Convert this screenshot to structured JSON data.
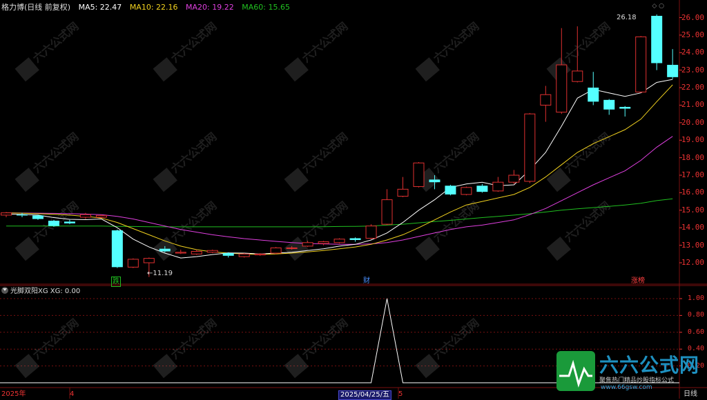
{
  "stock": {
    "name": "格力博(日线 前复权)"
  },
  "ma_labels": [
    {
      "text": "MA5: 22.47",
      "color": "#ffffff"
    },
    {
      "text": "MA10: 22.16",
      "color": "#f2d21f"
    },
    {
      "text": "MA20: 19.22",
      "color": "#e040e0"
    },
    {
      "text": "MA60: 15.65",
      "color": "#20c020"
    }
  ],
  "indicator": {
    "label": "光脚双阳XG  XG: 0.00"
  },
  "price_axis": [
    "26.00",
    "25.00",
    "24.00",
    "23.00",
    "22.00",
    "21.00",
    "20.00",
    "19.00",
    "18.00",
    "17.00",
    "16.00",
    "15.00",
    "14.00",
    "13.00",
    "12.00"
  ],
  "indicator_axis": [
    "1.00",
    "0.80",
    "0.60",
    "0.40",
    "0.20"
  ],
  "annotations": {
    "high": "26.18",
    "low": "11.19"
  },
  "event_markers": [
    {
      "text": "跌",
      "color": "#20c020"
    },
    {
      "text": "财",
      "color": "#4a90ff"
    },
    {
      "text": "涨榜",
      "color": "#ff4040"
    }
  ],
  "x_labels": {
    "year": "2025年",
    "m4": "4",
    "date": "2025/04/25/五",
    "m5": "5",
    "period": "日线"
  },
  "watermark": {
    "title": "六六公式网",
    "subtitle": "聚焦热门精品炒股指标公式",
    "url": "www.66gsw.com"
  },
  "colors": {
    "up": "#e03030",
    "down": "#54ffff",
    "ma5": "#ffffff",
    "ma10": "#f2d21f",
    "ma20": "#e040e0",
    "ma60": "#20c020",
    "grid": "#7a1010"
  },
  "chart_data": {
    "type": "candlestick",
    "ylim": [
      11.0,
      26.6
    ],
    "candles": [
      {
        "o": 14.72,
        "c": 14.85,
        "h": 14.9,
        "l": 14.6
      },
      {
        "o": 14.75,
        "c": 14.7,
        "h": 14.85,
        "l": 14.6
      },
      {
        "o": 14.7,
        "c": 14.5,
        "h": 14.75,
        "l": 14.45
      },
      {
        "o": 14.4,
        "c": 14.1,
        "h": 14.45,
        "l": 14.05
      },
      {
        "o": 14.35,
        "c": 14.25,
        "h": 14.45,
        "l": 14.2
      },
      {
        "o": 14.6,
        "c": 14.75,
        "h": 14.85,
        "l": 14.5
      },
      {
        "o": 14.6,
        "c": 14.7,
        "h": 14.75,
        "l": 14.55
      },
      {
        "o": 13.85,
        "c": 11.75,
        "h": 13.9,
        "l": 11.7
      },
      {
        "o": 11.75,
        "c": 12.2,
        "h": 12.25,
        "l": 11.7
      },
      {
        "o": 12.0,
        "c": 12.25,
        "h": 12.3,
        "l": 11.19
      },
      {
        "o": 12.8,
        "c": 12.65,
        "h": 12.95,
        "l": 12.6
      },
      {
        "o": 12.55,
        "c": 12.6,
        "h": 12.75,
        "l": 12.5
      },
      {
        "o": 12.5,
        "c": 12.65,
        "h": 12.75,
        "l": 12.45
      },
      {
        "o": 12.6,
        "c": 12.7,
        "h": 12.75,
        "l": 12.55
      },
      {
        "o": 12.55,
        "c": 12.4,
        "h": 12.6,
        "l": 12.3
      },
      {
        "o": 12.35,
        "c": 12.5,
        "h": 12.55,
        "l": 12.3
      },
      {
        "o": 12.45,
        "c": 12.5,
        "h": 12.55,
        "l": 12.4
      },
      {
        "o": 12.55,
        "c": 12.85,
        "h": 12.9,
        "l": 12.5
      },
      {
        "o": 12.85,
        "c": 12.85,
        "h": 12.95,
        "l": 12.75
      },
      {
        "o": 12.95,
        "c": 13.15,
        "h": 13.25,
        "l": 12.9
      },
      {
        "o": 13.1,
        "c": 13.2,
        "h": 13.25,
        "l": 13.0
      },
      {
        "o": 13.15,
        "c": 13.35,
        "h": 13.4,
        "l": 13.1
      },
      {
        "o": 13.4,
        "c": 13.3,
        "h": 13.45,
        "l": 13.2
      },
      {
        "o": 13.4,
        "c": 14.1,
        "h": 14.2,
        "l": 13.35
      },
      {
        "o": 14.2,
        "c": 15.6,
        "h": 16.2,
        "l": 14.15
      },
      {
        "o": 15.8,
        "c": 16.2,
        "h": 16.9,
        "l": 15.75
      },
      {
        "o": 16.35,
        "c": 17.7,
        "h": 17.75,
        "l": 16.3
      },
      {
        "o": 16.75,
        "c": 16.6,
        "h": 17.0,
        "l": 16.2
      },
      {
        "o": 16.4,
        "c": 15.9,
        "h": 16.45,
        "l": 15.85
      },
      {
        "o": 15.9,
        "c": 16.3,
        "h": 16.35,
        "l": 15.85
      },
      {
        "o": 16.4,
        "c": 16.05,
        "h": 16.5,
        "l": 16.0
      },
      {
        "o": 16.1,
        "c": 16.6,
        "h": 16.9,
        "l": 16.05
      },
      {
        "o": 16.6,
        "c": 17.0,
        "h": 17.3,
        "l": 16.5
      },
      {
        "o": 16.65,
        "c": 20.5,
        "h": 20.55,
        "l": 16.55
      },
      {
        "o": 21.0,
        "c": 21.6,
        "h": 22.1,
        "l": 20.05
      },
      {
        "o": 20.6,
        "c": 23.3,
        "h": 25.4,
        "l": 20.5
      },
      {
        "o": 22.35,
        "c": 22.95,
        "h": 25.5,
        "l": 22.3
      },
      {
        "o": 22.0,
        "c": 21.2,
        "h": 22.9,
        "l": 21.0
      },
      {
        "o": 21.3,
        "c": 20.75,
        "h": 21.35,
        "l": 20.45
      },
      {
        "o": 20.9,
        "c": 20.8,
        "h": 20.95,
        "l": 20.35
      },
      {
        "o": 21.75,
        "c": 24.9,
        "h": 24.95,
        "l": 21.7
      },
      {
        "o": 26.1,
        "c": 23.4,
        "h": 26.18,
        "l": 23.0
      },
      {
        "o": 23.3,
        "c": 22.6,
        "h": 24.2,
        "l": 22.5
      }
    ],
    "ma5": [
      14.78,
      14.76,
      14.72,
      14.58,
      14.48,
      14.46,
      14.5,
      14.0,
      13.35,
      12.9,
      12.55,
      12.27,
      12.35,
      12.47,
      12.56,
      12.55,
      12.5,
      12.55,
      12.6,
      12.7,
      12.8,
      12.95,
      13.05,
      13.3,
      13.7,
      14.3,
      15.0,
      15.6,
      16.3,
      16.5,
      16.6,
      16.4,
      16.45,
      17.3,
      18.3,
      19.8,
      21.4,
      21.9,
      21.7,
      21.5,
      21.7,
      22.3,
      22.47
    ],
    "ma10": [
      14.85,
      14.83,
      14.8,
      14.77,
      14.72,
      14.65,
      14.55,
      14.3,
      13.95,
      13.6,
      13.25,
      12.95,
      12.75,
      12.62,
      12.55,
      12.5,
      12.48,
      12.5,
      12.55,
      12.62,
      12.7,
      12.8,
      12.9,
      13.05,
      13.3,
      13.6,
      14.0,
      14.45,
      14.9,
      15.3,
      15.5,
      15.7,
      15.9,
      16.3,
      16.9,
      17.6,
      18.3,
      18.8,
      19.2,
      19.6,
      20.2,
      21.2,
      22.16
    ],
    "ma20": [
      14.85,
      14.84,
      14.83,
      14.82,
      14.8,
      14.78,
      14.75,
      14.65,
      14.5,
      14.3,
      14.1,
      13.9,
      13.75,
      13.6,
      13.48,
      13.38,
      13.3,
      13.22,
      13.15,
      13.1,
      13.08,
      13.05,
      13.05,
      13.08,
      13.15,
      13.3,
      13.5,
      13.7,
      13.9,
      14.05,
      14.15,
      14.3,
      14.45,
      14.75,
      15.1,
      15.55,
      16.0,
      16.45,
      16.85,
      17.25,
      17.85,
      18.6,
      19.22
    ],
    "ma60": [
      14.1,
      14.1,
      14.1,
      14.1,
      14.1,
      14.1,
      14.1,
      14.08,
      14.07,
      14.06,
      14.05,
      14.05,
      14.05,
      14.05,
      14.05,
      14.05,
      14.05,
      14.05,
      14.05,
      14.05,
      14.06,
      14.07,
      14.08,
      14.1,
      14.15,
      14.2,
      14.28,
      14.35,
      14.42,
      14.5,
      14.58,
      14.65,
      14.72,
      14.8,
      14.9,
      15.0,
      15.08,
      15.15,
      15.22,
      15.3,
      15.4,
      15.55,
      15.65
    ],
    "xg_spike_index": 24,
    "xg_ylim": [
      0,
      1.0
    ]
  }
}
